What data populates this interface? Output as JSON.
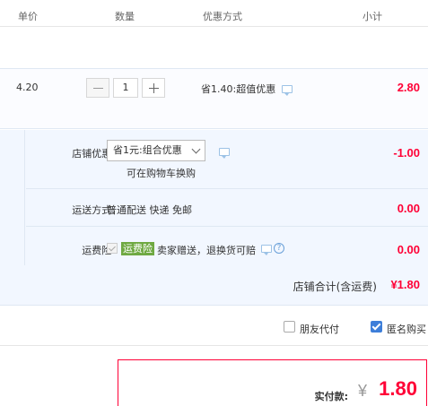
{
  "header": {
    "unit_price": "单价",
    "quantity": "数量",
    "promotion": "优惠方式",
    "subtotal": "小计"
  },
  "item": {
    "unit_price": "4.20",
    "quantity": "1",
    "promotion": "省1.40:超值优惠",
    "subtotal": "2.80"
  },
  "shop": {
    "discount_label": "店铺优惠:",
    "discount_select": "省1元:组合优惠",
    "discount_note": "可在购物车换购",
    "discount_amount": "-1.00",
    "shipping_label": "运送方式:",
    "shipping_value": "普通配送 快递 免邮",
    "shipping_amount": "0.00",
    "insurance_label": "运费险:",
    "insurance_badge": "运费险",
    "insurance_text": "卖家赠送，退换货可赔",
    "insurance_amount": "0.00",
    "total_label": "店铺合计(含运费)",
    "total_amount": "¥1.80"
  },
  "options": {
    "friend_pay": "朋友代付",
    "anonymous": "匿名购买"
  },
  "payment": {
    "label": "实付款:",
    "currency": "¥",
    "amount": "1.80"
  },
  "colors": {
    "accent_red": "#ff0036",
    "row_bg": "#f2f7ff",
    "badge_green": "#6fa942",
    "checkbox_blue": "#3d7ed9"
  }
}
